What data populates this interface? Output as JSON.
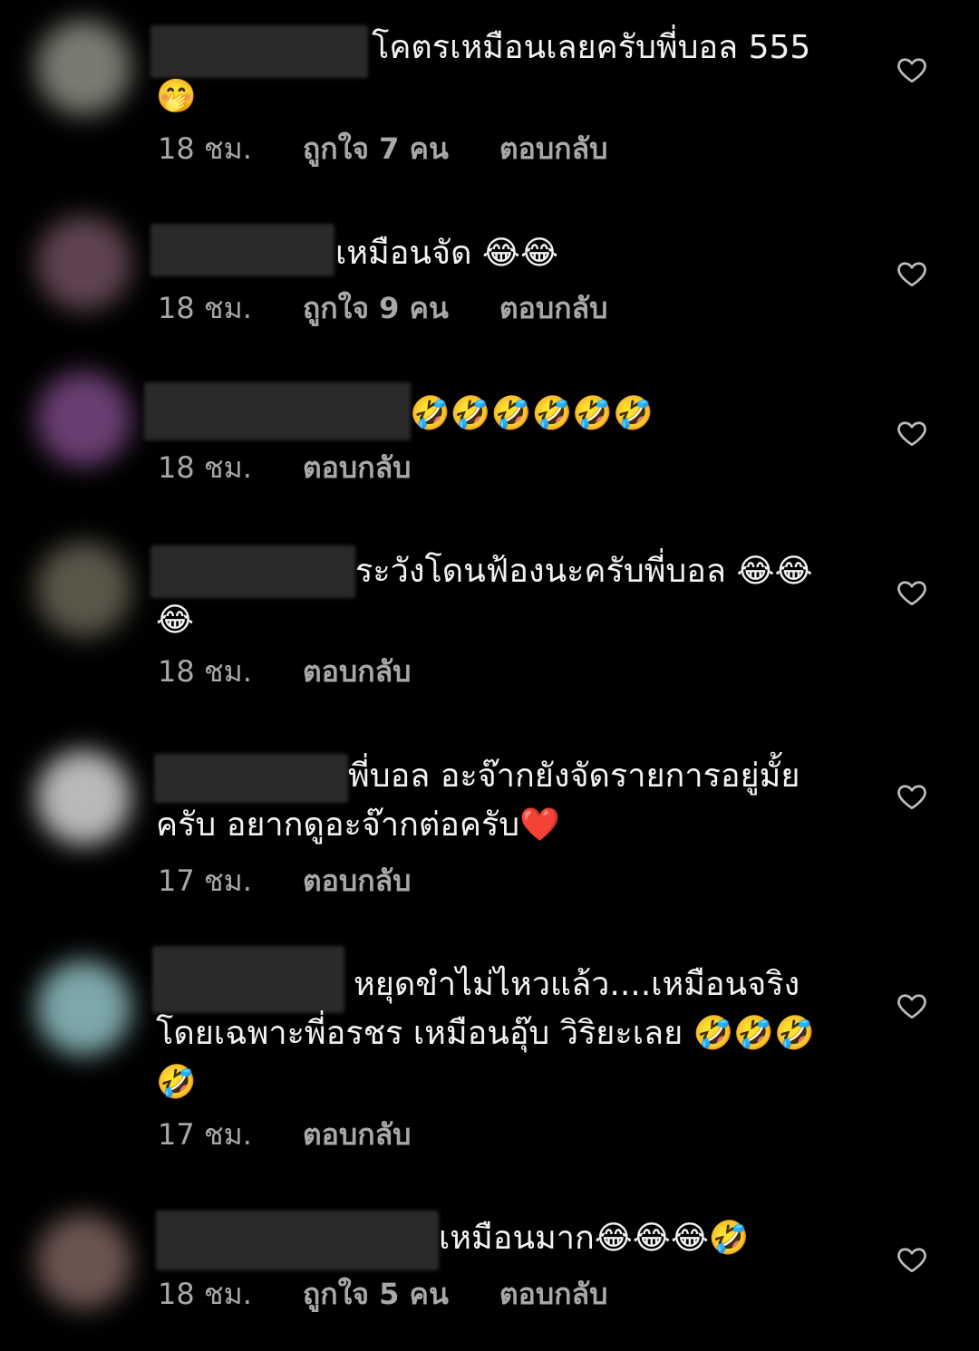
{
  "comments": [
    {
      "text": "โคตรเหมือนเลยครับพี่บอล 555\n🤭",
      "time": "18 ชม.",
      "likes": "ถูกใจ 7 คน",
      "reply": "ตอบกลับ",
      "avatar_color": "#7a7a72"
    },
    {
      "text": "เหมือนจัด 😂😂",
      "time": "18 ชม.",
      "likes": "ถูกใจ 9 คน",
      "reply": "ตอบกลับ",
      "avatar_color": "#5e4450"
    },
    {
      "text": "🤣🤣🤣🤣🤣🤣",
      "time": "18 ชม.",
      "likes": "",
      "reply": "ตอบกลับ",
      "avatar_color": "#6a3e72"
    },
    {
      "text": "ระวังโดนฟ้องนะครับพี่บอล 😂😂\n😂",
      "time": "18 ชม.",
      "likes": "",
      "reply": "ตอบกลับ",
      "avatar_color": "#5a5648"
    },
    {
      "text": "พี่บอล อะจ๊ากยังจัดรายการอยู่มั้ย\nครับ อยากดูอะจ๊ากต่อครับ❤️",
      "time": "17 ชม.",
      "likes": "",
      "reply": "ตอบกลับ",
      "avatar_color": "#b9b9b9"
    },
    {
      "text": "หยุดขำไม่ไหวแล้ว....เหมือนจริง\nโดยเฉพาะพี่อรชร เหมือนอุ๊บ วิริยะเลย 🤣🤣🤣\n🤣",
      "time": "17 ชม.",
      "likes": "",
      "reply": "ตอบกลับ",
      "avatar_color": "#7ea7aa"
    },
    {
      "text": "เหมือนมาก😂😂😂🤣",
      "time": "18 ชม.",
      "likes": "ถูกใจ 5 คน",
      "reply": "ตอบกลับ",
      "avatar_color": "#6b5550"
    }
  ]
}
